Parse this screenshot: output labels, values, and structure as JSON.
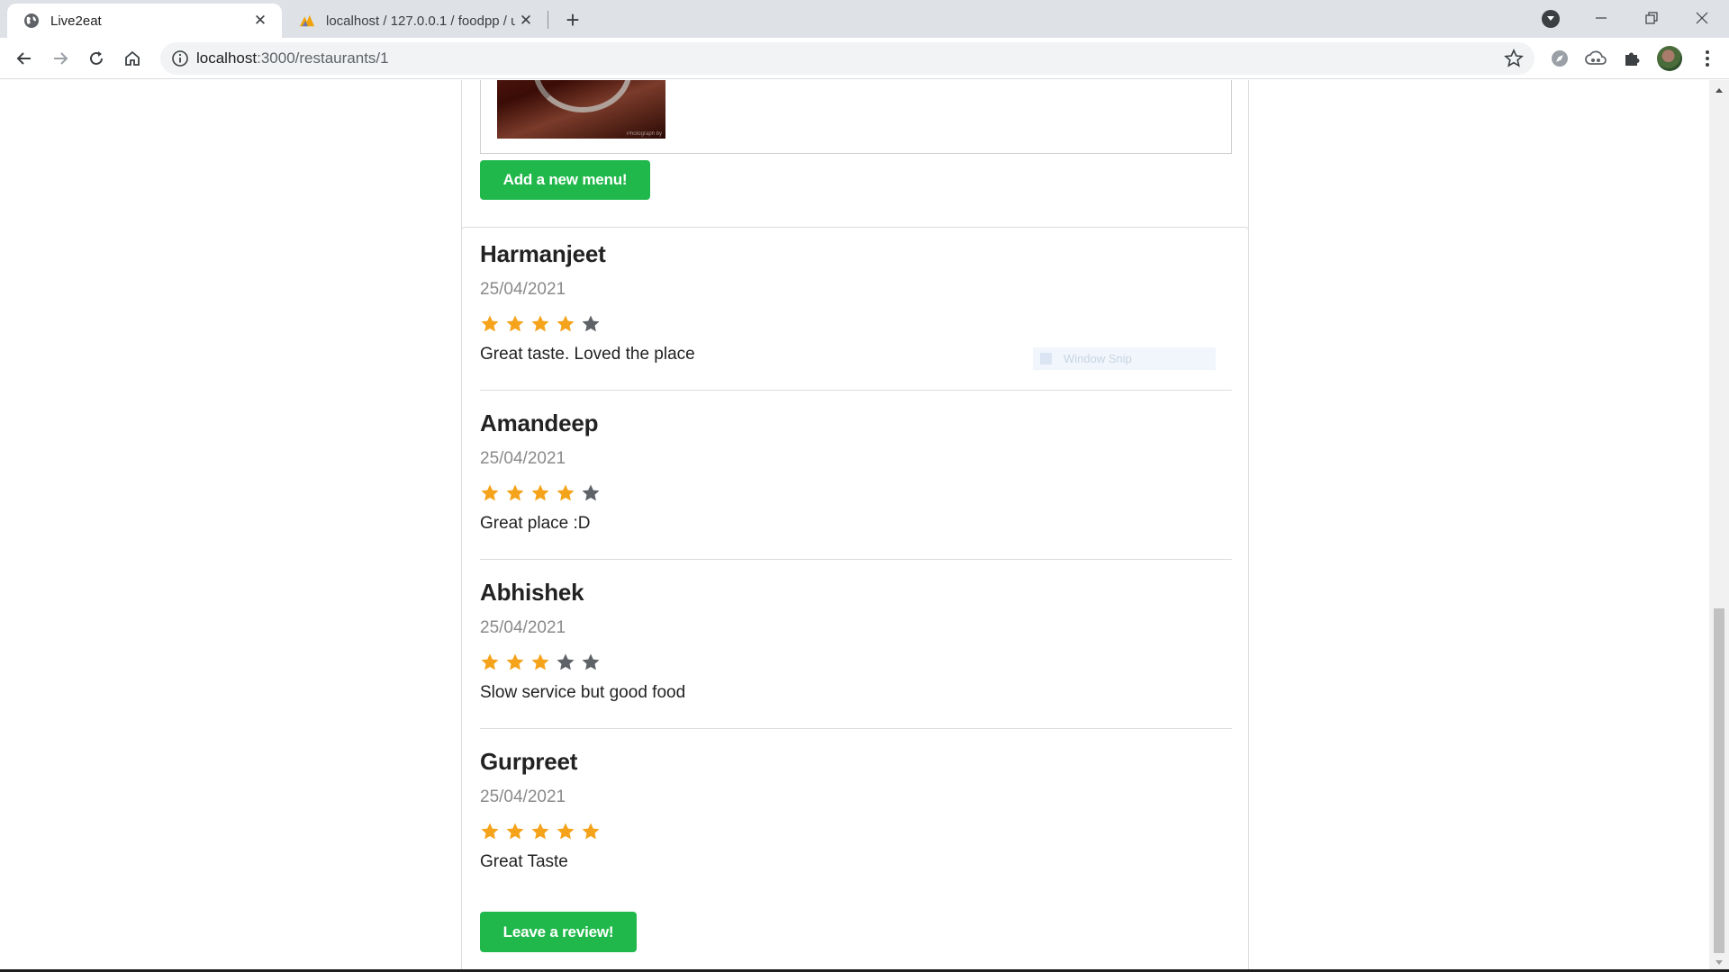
{
  "browser": {
    "tabs": [
      {
        "title": "Live2eat",
        "active": true,
        "favicon": "globe-icon"
      },
      {
        "title": "localhost / 127.0.0.1 / foodpp / u",
        "active": false,
        "favicon": "phpmyadmin-icon"
      }
    ],
    "url_host": "localhost",
    "url_path": ":3000/restaurants/1",
    "colors": {
      "tabbar": "#dee1e6",
      "toolbar": "#ffffff",
      "omnibox": "#f1f3f4"
    }
  },
  "menu_section": {
    "add_menu_label": "Add a new menu!"
  },
  "overlay": {
    "snip_label": "Window Snip"
  },
  "reviews": [
    {
      "author": "Harmanjeet",
      "date": "25/04/2021",
      "rating": 4,
      "comment": "Great taste. Loved the place"
    },
    {
      "author": "Amandeep",
      "date": "25/04/2021",
      "rating": 4,
      "comment": "Great place :D"
    },
    {
      "author": "Abhishek",
      "date": "25/04/2021",
      "rating": 3,
      "comment": "Slow service but good food"
    },
    {
      "author": "Gurpreet",
      "date": "25/04/2021",
      "rating": 5,
      "comment": "Great Taste"
    }
  ],
  "leave_review_label": "Leave a review!",
  "colors": {
    "accent_green": "#21b84b",
    "star_filled": "#f5a31a",
    "star_empty": "#5f6368"
  }
}
